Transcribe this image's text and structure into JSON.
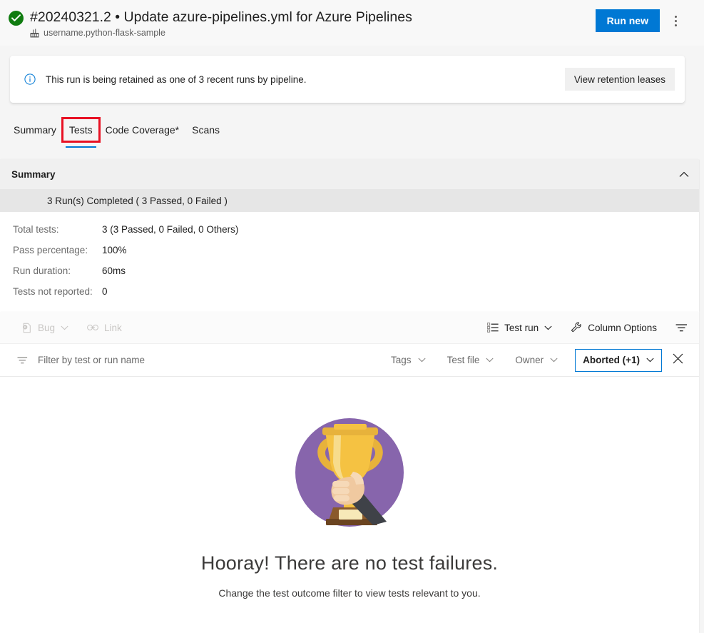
{
  "header": {
    "status_icon": "success-check-icon",
    "status_color": "#107c10",
    "run_title": "#20240321.2 • Update azure-pipelines.yml for Azure Pipelines",
    "pipeline_icon": "pipeline-icon",
    "pipeline_name": "username.python-flask-sample",
    "run_new_label": "Run new",
    "run_new_color": "#0078d4",
    "more_actions_icon": "more-actions-icon"
  },
  "banner": {
    "info_icon": "info-icon",
    "message": "This run is being retained as one of 3 recent runs by pipeline.",
    "action_label": "View retention leases"
  },
  "tabs": {
    "items": [
      {
        "label": "Summary",
        "selected": false
      },
      {
        "label": "Tests",
        "selected": true
      },
      {
        "label": "Code Coverage*",
        "selected": false
      },
      {
        "label": "Scans",
        "selected": false
      }
    ],
    "selected_index": 1,
    "selected_underline_color": "#0078d4",
    "highlight_box_color": "#e81123"
  },
  "summary": {
    "heading": "Summary",
    "collapse_icon": "chevron-up-icon",
    "run_line": "3 Run(s) Completed ( 3 Passed, 0 Failed )",
    "stats": [
      {
        "label": "Total tests:",
        "value": "3 (3 Passed, 0 Failed, 0 Others)"
      },
      {
        "label": "Pass percentage:",
        "value": "100%"
      },
      {
        "label": "Run duration:",
        "value": "60ms"
      },
      {
        "label": "Tests not reported:",
        "value": "0"
      }
    ]
  },
  "toolbar": {
    "bug_icon": "bug-icon",
    "bug_label": "Bug",
    "bug_caret": "chevron-down-icon",
    "link_icon": "link-icon",
    "link_label": "Link",
    "group_icon": "group-by-icon",
    "group_label": "Test run",
    "group_caret": "chevron-down-icon",
    "column_options_icon": "wrench-icon",
    "column_options_label": "Column Options",
    "filter_toggle_icon": "filter-icon"
  },
  "filters": {
    "filter_icon": "filter-icon",
    "filter_placeholder": "Filter by test or run name",
    "filter_value": "",
    "pickers": [
      {
        "label": "Tags",
        "caret": "chevron-down-icon",
        "active": false
      },
      {
        "label": "Test file",
        "caret": "chevron-down-icon",
        "active": false
      },
      {
        "label": "Owner",
        "caret": "chevron-down-icon",
        "active": false
      },
      {
        "label": "Aborted (+1)",
        "caret": "chevron-down-icon",
        "active": true
      }
    ],
    "clear_icon": "close-icon",
    "active_border_color": "#0078d4"
  },
  "empty_state": {
    "illustration": "trophy-in-hand-illustration",
    "circle_color": "#8765ac",
    "trophy_color": "#f5c242",
    "title": "Hooray! There are no test failures.",
    "subtitle": "Change the test outcome filter to view tests relevant to you."
  }
}
